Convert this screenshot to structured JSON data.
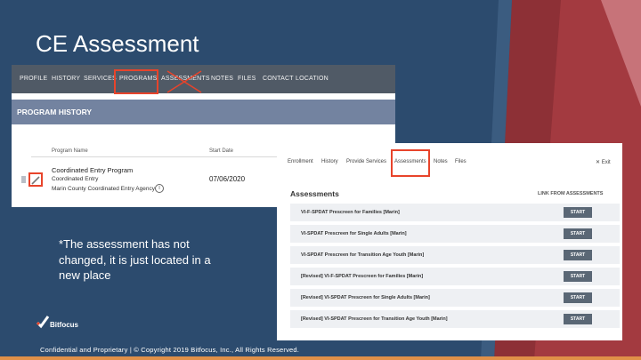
{
  "slide": {
    "title": "CE Assessment",
    "note": "*The assessment has not changed, it is just located in a new place",
    "logo_text": "Bitfocus",
    "footer": "Confidential and Proprietary | © Copyright 2019 Bitfocus, Inc., All Rights Reserved."
  },
  "colors": {
    "background": "#2c4b6e",
    "highlight": "#e8442b",
    "accent_red": "#b03a3f",
    "nav_dark": "#505a66",
    "band": "#7383a0",
    "bottom_bar": "#e09048"
  },
  "program_screen": {
    "tabs": [
      "PROFILE",
      "HISTORY",
      "SERVICES",
      "PROGRAMS",
      "ASSESSMENTS",
      "NOTES",
      "FILES",
      "CONTACT",
      "LOCATION"
    ],
    "band_title": "PROGRAM HISTORY",
    "columns": {
      "name": "Program Name",
      "start": "Start Date"
    },
    "program": {
      "name": "Coordinated Entry Program",
      "sub1": "Coordinated Entry",
      "sub2": "Marin County Coordinated Entry Agency",
      "start_date": "07/06/2020"
    }
  },
  "enrollment_screen": {
    "tabs": [
      "Enrollment",
      "History",
      "Provide Services",
      "Assessments",
      "Notes",
      "Files"
    ],
    "exit_label": "✕ Exit",
    "heading": "Assessments",
    "link_label": "LINK FROM ASSESSMENTS",
    "start_label": "START",
    "assessments": [
      "VI-F-SPDAT Prescreen for Families [Marin]",
      "VI-SPDAT Prescreen for Single Adults [Marin]",
      "VI-SPDAT Prescreen for Transition Age Youth [Marin]",
      "[Revised] VI-F-SPDAT Prescreen for Families [Marin]",
      "[Revised] VI-SPDAT Prescreen for Single Adults [Marin]",
      "[Revised] VI-SPDAT Prescreen for Transition Age Youth [Marin]"
    ]
  }
}
